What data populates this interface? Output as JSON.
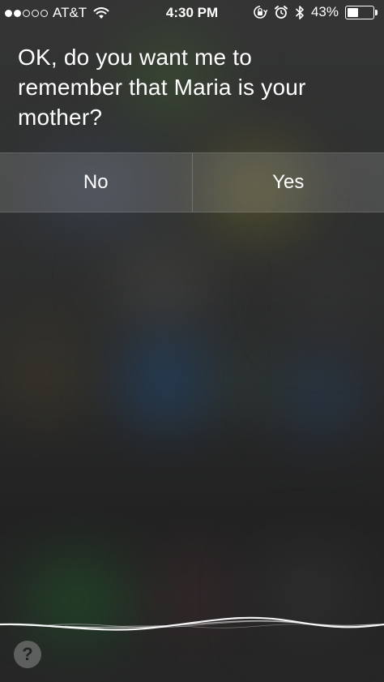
{
  "status_bar": {
    "signal_filled": 2,
    "signal_total": 5,
    "carrier": "AT&T",
    "time": "4:30 PM",
    "battery_percent": "43%",
    "battery_level": 0.43,
    "icons": [
      "wifi-icon",
      "rotation-lock-icon",
      "alarm-icon",
      "bluetooth-icon",
      "battery-icon"
    ]
  },
  "siri": {
    "message": "OK, do you want me to remember that Maria is your mother?"
  },
  "choices": {
    "no_label": "No",
    "yes_label": "Yes"
  },
  "help": {
    "label": "?"
  },
  "colors": {
    "text": "#ffffff",
    "choice_bar": "rgba(255,255,255,0.14)",
    "help_button": "#8c8c8c"
  }
}
